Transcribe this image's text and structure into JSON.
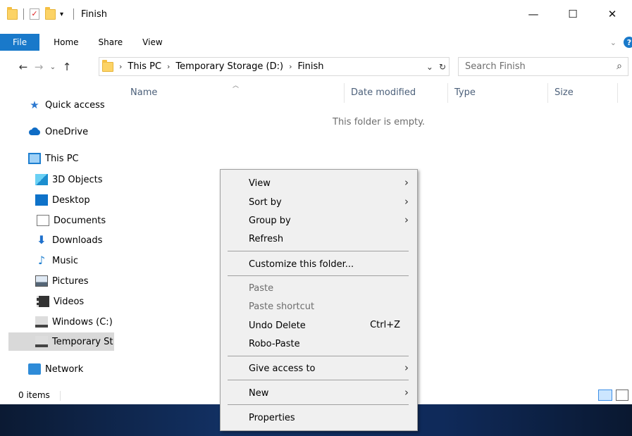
{
  "window": {
    "title": "Finish",
    "controls": {
      "minimize": "—",
      "maximize": "☐",
      "close": "✕"
    }
  },
  "ribbon": {
    "tabs": [
      "File",
      "Home",
      "Share",
      "View"
    ],
    "expand": "⌄",
    "help": "?"
  },
  "nav": {
    "back": "←",
    "forward": "→",
    "recent": "⌄",
    "up": "↑"
  },
  "address": {
    "crumbs": [
      "This PC",
      "Temporary Storage (D:)",
      "Finish"
    ],
    "separator": "›",
    "dropdown": "⌄",
    "refresh": "↻"
  },
  "search": {
    "placeholder": "Search Finish",
    "icon": "⌕"
  },
  "sidebar": {
    "items": [
      {
        "label": "Quick access",
        "icon": "star-icon"
      },
      {
        "label": "OneDrive",
        "icon": "cloud-icon"
      },
      {
        "label": "This PC",
        "icon": "computer-icon"
      },
      {
        "label": "3D Objects",
        "icon": "cube-icon"
      },
      {
        "label": "Desktop",
        "icon": "desktop-icon"
      },
      {
        "label": "Documents",
        "icon": "document-icon"
      },
      {
        "label": "Downloads",
        "icon": "download-icon"
      },
      {
        "label": "Music",
        "icon": "music-icon"
      },
      {
        "label": "Pictures",
        "icon": "pictures-icon"
      },
      {
        "label": "Videos",
        "icon": "video-icon"
      },
      {
        "label": "Windows (C:)",
        "icon": "drive-icon"
      },
      {
        "label": "Temporary St",
        "icon": "drive-icon",
        "selected": true
      },
      {
        "label": "Network",
        "icon": "network-icon"
      }
    ]
  },
  "columns": [
    "Name",
    "Date modified",
    "Type",
    "Size"
  ],
  "content": {
    "empty_message": "This folder is empty."
  },
  "statusbar": {
    "items_count": "0 items"
  },
  "context_menu": {
    "items": [
      {
        "label": "View",
        "submenu": true
      },
      {
        "label": "Sort by",
        "submenu": true
      },
      {
        "label": "Group by",
        "submenu": true
      },
      {
        "label": "Refresh"
      },
      {
        "label": "Customize this folder..."
      },
      {
        "label": "Paste",
        "disabled": true
      },
      {
        "label": "Paste shortcut",
        "disabled": true
      },
      {
        "label": "Undo Delete",
        "shortcut": "Ctrl+Z"
      },
      {
        "label": "Robo-Paste"
      },
      {
        "label": "Give access to",
        "submenu": true
      },
      {
        "label": "New",
        "submenu": true
      },
      {
        "label": "Properties"
      }
    ],
    "submenu_arrow": "›"
  },
  "colors": {
    "accent": "#1979ca",
    "selected_bg": "#d9d9d9",
    "menu_bg": "#f0f0f0",
    "disabled_text": "#6d6d6d"
  }
}
